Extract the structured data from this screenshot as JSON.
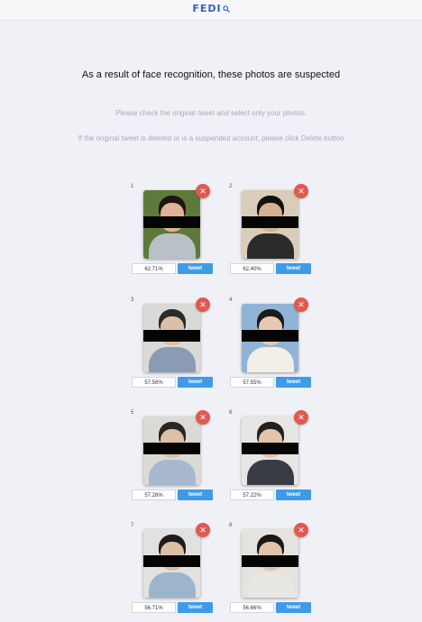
{
  "header": {
    "logo_text": "FEDI",
    "logo_icon": "search-icon",
    "brand_color": "#2e63b8"
  },
  "main": {
    "headline": "As a result of face recognition, these photos are suspected",
    "instruction_1": "Please check the original tweet and select only your photos.",
    "instruction_2": "If the original tweet is deleted or is a suspended account, please click Delete button"
  },
  "colors": {
    "close_button": "#e05a4f",
    "tweet_button": "#3e9be8",
    "page_background": "#f0f1f6"
  },
  "photos": [
    {
      "number": "1",
      "score": "62.71%",
      "tweet_label": "tweet",
      "close_icon": "close-icon",
      "colors": {
        "bg": "#5e7a3a",
        "hair": "#1c1512",
        "face": "#e0b394",
        "body": "#b9c0c6"
      }
    },
    {
      "number": "2",
      "score": "62.40%",
      "tweet_label": "tweet",
      "close_icon": "close-icon",
      "colors": {
        "bg": "#d9cdb9",
        "hair": "#15110f",
        "face": "#d4b095",
        "body": "#2a2a2a"
      }
    },
    {
      "number": "3",
      "score": "57.56%",
      "tweet_label": "tweet",
      "close_icon": "close-icon",
      "colors": {
        "bg": "#d9d9d7",
        "hair": "#2b2b2b",
        "face": "#dcbfa8",
        "body": "#8a9bb4"
      }
    },
    {
      "number": "4",
      "score": "57.55%",
      "tweet_label": "tweet",
      "close_icon": "close-icon",
      "colors": {
        "bg": "#8fb4d6",
        "hair": "#1d1b1a",
        "face": "#e6c9b2",
        "body": "#f2efe8"
      }
    },
    {
      "number": "5",
      "score": "57.28%",
      "tweet_label": "tweet",
      "close_icon": "close-icon",
      "colors": {
        "bg": "#dcdad5",
        "hair": "#2a2623",
        "face": "#dcc0a7",
        "body": "#a8b9cf"
      }
    },
    {
      "number": "6",
      "score": "57.22%",
      "tweet_label": "tweet",
      "close_icon": "close-icon",
      "colors": {
        "bg": "#e8e6e4",
        "hair": "#242020",
        "face": "#e3c4ad",
        "body": "#3a3c45"
      }
    },
    {
      "number": "7",
      "score": "56.71%",
      "tweet_label": "tweet",
      "close_icon": "close-icon",
      "colors": {
        "bg": "#e3e1df",
        "hair": "#1f1b19",
        "face": "#dbbfa6",
        "body": "#9db5cc"
      }
    },
    {
      "number": "8",
      "score": "56.66%",
      "tweet_label": "tweet",
      "close_icon": "close-icon",
      "colors": {
        "bg": "#e6e2dd",
        "hair": "#1b1816",
        "face": "#e0c3ab",
        "body": "#e9e7e4"
      }
    }
  ]
}
